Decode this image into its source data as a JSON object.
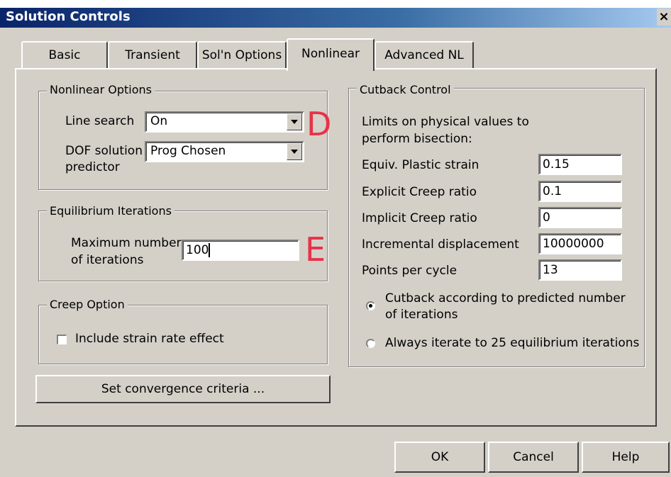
{
  "window": {
    "title": "Solution Controls",
    "close_glyph": "×"
  },
  "tabs": [
    {
      "label": "Basic"
    },
    {
      "label": "Transient"
    },
    {
      "label": "Sol'n Options"
    },
    {
      "label": "Nonlinear",
      "selected": true
    },
    {
      "label": "Advanced NL"
    }
  ],
  "nonlinear_options": {
    "legend": "Nonlinear Options",
    "line_search_label": "Line search",
    "line_search_value": "On",
    "dof_label_line1": "DOF solution",
    "dof_label_line2": "predictor",
    "dof_value": "Prog Chosen"
  },
  "equilibrium": {
    "legend": "Equilibrium Iterations",
    "max_label_line1": "Maximum number",
    "max_label_line2": "of iterations",
    "max_value": "100"
  },
  "creep": {
    "legend": "Creep Option",
    "include_label": "Include strain rate effect",
    "include_checked": false
  },
  "convergence_button": "Set convergence criteria ...",
  "cutback": {
    "legend": "Cutback Control",
    "intro_line1": "Limits on physical values to",
    "intro_line2": "perform bisection:",
    "fields": [
      {
        "label": "Equiv. Plastic strain",
        "value": "0.15"
      },
      {
        "label": "Explicit Creep ratio",
        "value": "0.1"
      },
      {
        "label": "Implicit Creep ratio",
        "value": "0"
      },
      {
        "label": "Incremental displacement",
        "value": "10000000"
      },
      {
        "label": "Points per cycle",
        "value": "13"
      }
    ],
    "radio1_line1": "Cutback according to predicted number",
    "radio1_line2": "of iterations",
    "radio1_selected": true,
    "radio2_label": "Always iterate to 25 equilibrium iterations",
    "radio2_selected": false
  },
  "annotations": {
    "d": "D",
    "e": "E",
    "color": "#e8314a"
  },
  "buttons": {
    "ok": "OK",
    "cancel": "Cancel",
    "help": "Help"
  },
  "icons": [
    "dropdown-arrow-icon",
    "close-icon"
  ]
}
